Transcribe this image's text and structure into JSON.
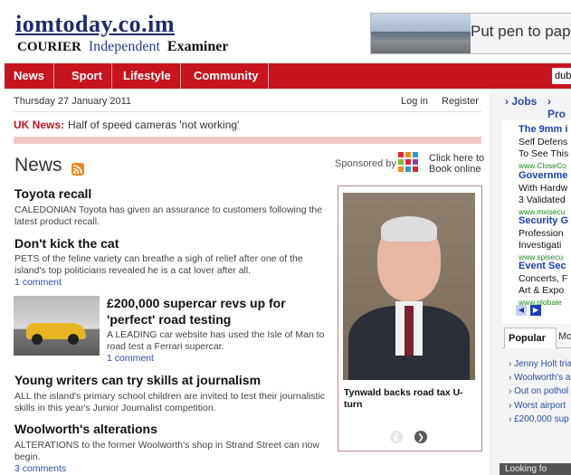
{
  "header": {
    "site_logo": "iomtoday.co.im",
    "papers": {
      "courier": "COURIER",
      "independent": "Independent",
      "examiner": "Examiner"
    },
    "banner_text": "Put pen to pap"
  },
  "nav": {
    "items": [
      "News",
      "Sport",
      "Lifestyle",
      "Community"
    ],
    "search_value": "dub"
  },
  "date_bar": {
    "date": "Thursday 27 January 2011",
    "login": "Log in",
    "register": "Register"
  },
  "uk_news": {
    "label": "UK News:",
    "headline": "Half of speed cameras 'not working'"
  },
  "news_section": {
    "heading": "News",
    "sponsored_by": "Sponsored by",
    "sponsor_link": "Click here to\nBook online"
  },
  "stories": [
    {
      "title": "Toyota recall",
      "summary": "CALEDONIAN Toyota has given an assurance to customers following the latest product recall.",
      "comments": ""
    },
    {
      "title": "Don't kick the cat",
      "summary": "PETS of the feline variety can breathe a sigh of relief after one of the island's top politicians revealed he is a cat lover after all.",
      "comments": "1 comment"
    },
    {
      "title": "£200,000 supercar revs up for 'perfect' road testing",
      "summary": "A LEADING car website has used the Isle of Man to road test a Ferrari supercar.",
      "comments": "1 comment"
    },
    {
      "title": "Young writers can try skills at journalism",
      "summary": "ALL the island's primary school children are invited to test their journalistic skills in this year's Junior Journalist competition.",
      "comments": ""
    },
    {
      "title": "Woolworth's alterations",
      "summary": "ALTERATIONS to the former Woolworth's shop in Strand Street can now begin.",
      "comments": "3 comments"
    }
  ],
  "featured": {
    "caption": "Tynwald backs road tax U-turn"
  },
  "right_col": {
    "jobs": "Jobs",
    "pro": "Pro",
    "ads": [
      {
        "title": "The 9mm i",
        "lines": [
          "Self Defens",
          "To See This"
        ],
        "url": "www.CloseCo"
      },
      {
        "title": "Governme",
        "lines": [
          "With Hardw",
          "3 Validated"
        ],
        "url": "www.mxisecu"
      },
      {
        "title": "Security G",
        "lines": [
          "Profession",
          "Investigati"
        ],
        "url": "www.spisecu"
      },
      {
        "title": "Event Sec",
        "lines": [
          "Concerts, F",
          "Art & Expo"
        ],
        "url": "www.globale"
      }
    ],
    "popular_tab": "Popular",
    "more_tab": "Mo",
    "popular_items": [
      "Jenny Holt tria",
      "Woolworth's a",
      "Out on pothol",
      "Worst airport ",
      "£200,000 sup"
    ],
    "looking_for": "Looking fo"
  },
  "colors": {
    "brand_red": "#c8141e",
    "link_blue": "#2a4f9e",
    "ad_title_blue": "#1a3fb0",
    "ad_url_green": "#1a8a1a"
  }
}
